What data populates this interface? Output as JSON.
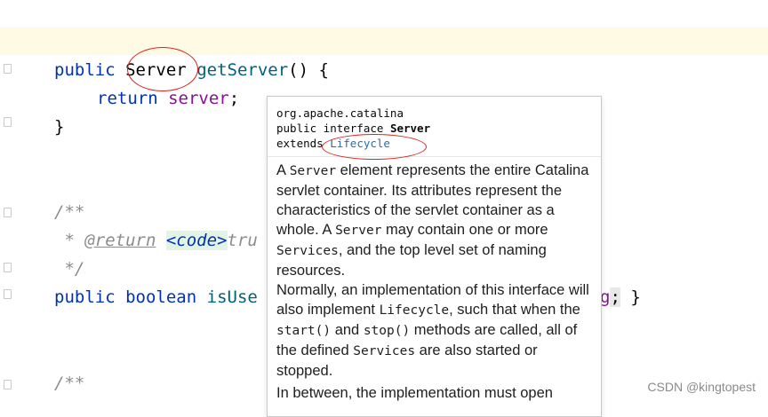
{
  "editor": {
    "line1": {
      "kw": "public",
      "type": "Server",
      "name": "getServer",
      "rest": "() {"
    },
    "line2": {
      "kw": "return",
      "field": "server",
      "semi": ";"
    },
    "line3": {
      "brace": "}"
    },
    "javadoc1": {
      "open": "/**",
      "star_tag": " * ",
      "tag": "@return",
      "sp": " ",
      "code": "<code>",
      "tail": "tru",
      "close": " */"
    },
    "line4": {
      "kw1": "public",
      "kw2": "boolean",
      "name_part": "isUse",
      "tail_field": "g",
      "tail_rest": ";",
      "close": " }"
    },
    "javadoc2": {
      "open": "/**"
    }
  },
  "popup": {
    "package": "org.apache.catalina",
    "decl_prefix": "public interface ",
    "decl_name": "Server",
    "extends_prefix": "extends ",
    "extends_link": "Lifecycle",
    "p1": [
      {
        "t": "A ",
        "mono": false
      },
      {
        "t": "Server",
        "mono": true
      },
      {
        "t": " element represents the entire Catalina servlet container. Its attributes represent the characteristics of the servlet container as a whole. A ",
        "mono": false
      },
      {
        "t": "Server",
        "mono": true
      },
      {
        "t": " may contain one or more ",
        "mono": false
      },
      {
        "t": "Services",
        "mono": true
      },
      {
        "t": ", and the top level set of naming resources.",
        "mono": false
      }
    ],
    "p2": [
      {
        "t": "Normally, an implementation of this interface will also implement ",
        "mono": false
      },
      {
        "t": "Lifecycle",
        "mono": true
      },
      {
        "t": ", such that when the ",
        "mono": false
      },
      {
        "t": "start()",
        "mono": true
      },
      {
        "t": " and ",
        "mono": false
      },
      {
        "t": "stop()",
        "mono": true
      },
      {
        "t": " methods are called, all of the defined ",
        "mono": false
      },
      {
        "t": "Services",
        "mono": true
      },
      {
        "t": " are also started or stopped.",
        "mono": false
      }
    ],
    "p3": "In between, the implementation must open"
  },
  "watermark": "CSDN @kingtopest"
}
